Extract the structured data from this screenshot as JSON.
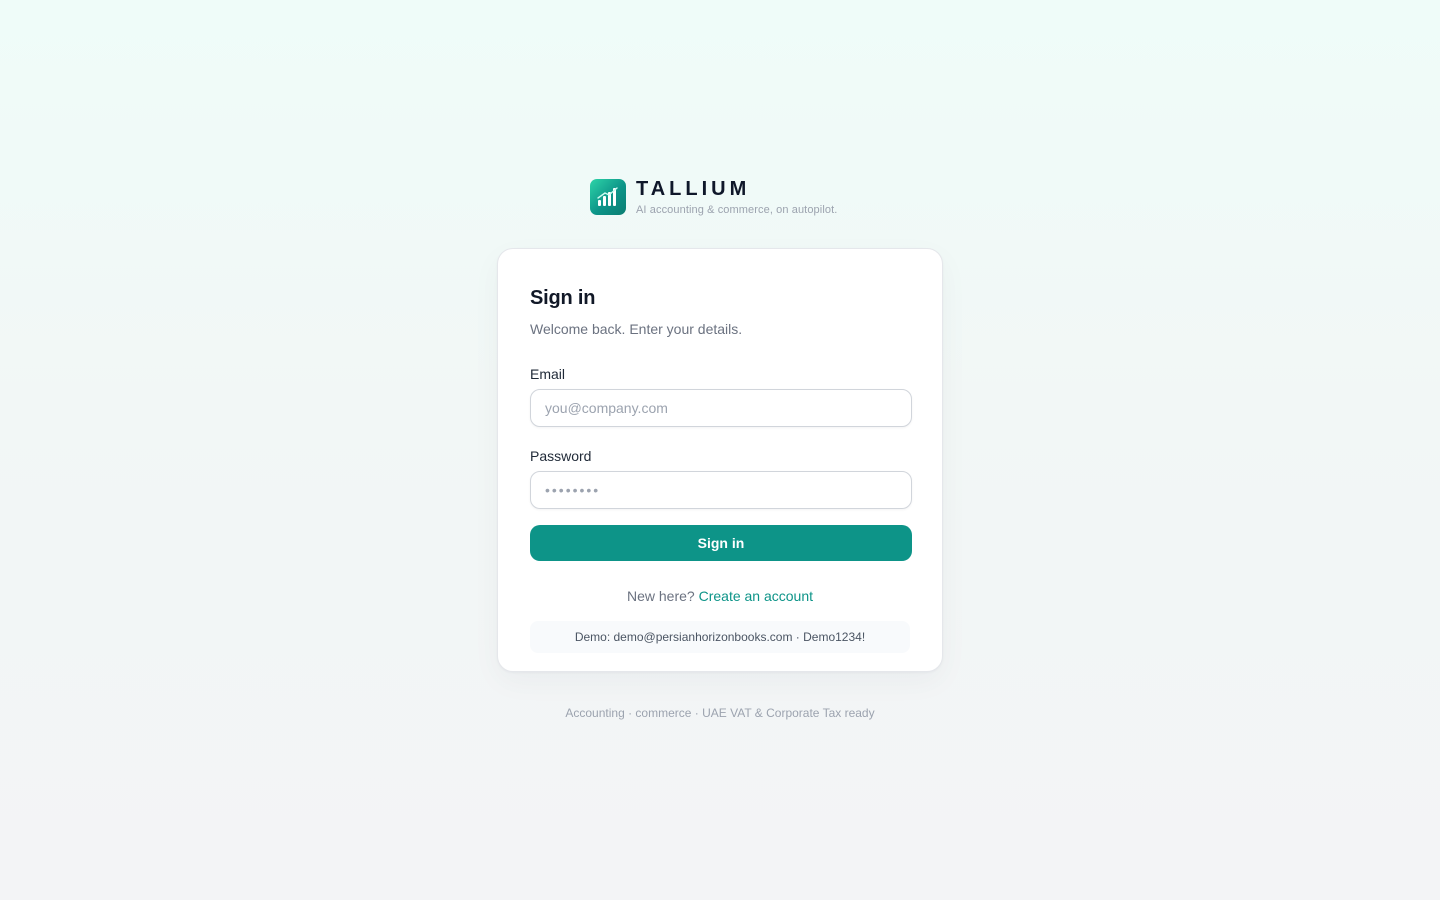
{
  "brand": {
    "logo_icon": "bar-chart-growth-icon",
    "name": "TALLIUM",
    "tagline": "AI accounting & commerce, on autopilot."
  },
  "card": {
    "title": "Sign in",
    "subtitle": "Welcome back. Enter your details.",
    "email": {
      "label": "Email",
      "placeholder": "you@company.com",
      "value": ""
    },
    "password": {
      "label": "Password",
      "placeholder": "••••••••",
      "value": ""
    },
    "submit_label": "Sign in",
    "signup_prompt": "New here?",
    "signup_link": "Create an account",
    "demo_credentials": "Demo: demo@persianhorizonbooks.com · Demo1234!"
  },
  "footer": {
    "note": "Accounting · commerce · UAE VAT & Corporate Tax ready"
  },
  "colors": {
    "accent": "#0d9488",
    "background_top": "#effcf9",
    "background_bottom": "#f3f4f6",
    "card": "#ffffff",
    "title": "#111827"
  }
}
